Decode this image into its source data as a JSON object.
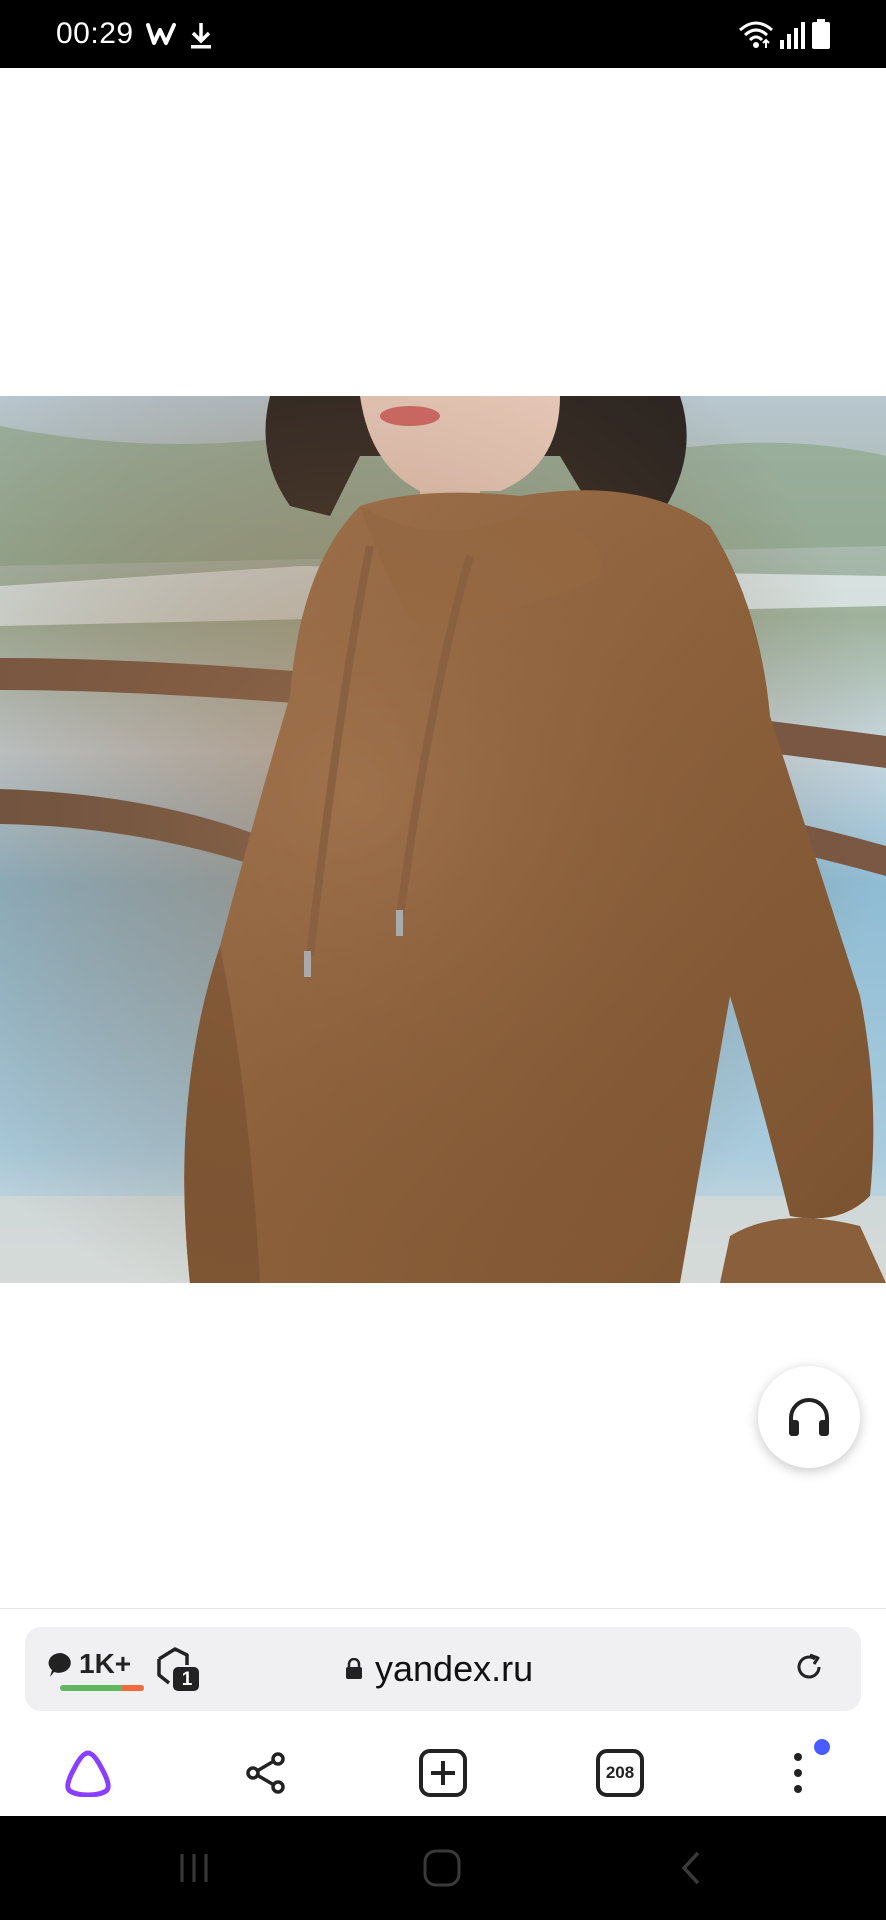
{
  "status_bar": {
    "time": "00:29",
    "icons": [
      "w-app-icon",
      "download-icon",
      "wifi-icon",
      "signal-icon",
      "battery-icon"
    ]
  },
  "page": {
    "image": "product-photo-brown-hoodie"
  },
  "audio_button": {
    "icon": "headphones-icon"
  },
  "browser": {
    "comments_count": "1K+",
    "protect_badge": "1",
    "url": "yandex.ru",
    "tabs_count": "208",
    "accent": "#8a3ffc",
    "notification_dot_color": "#4a5cff",
    "rating_bar_colors": [
      "#5cb85c",
      "#f06a3c"
    ],
    "nav_icons": [
      "alice-icon",
      "share-icon",
      "new-tab-icon",
      "tabs-icon",
      "menu-icon"
    ]
  },
  "system_nav": {
    "icons": [
      "recents-icon",
      "home-icon",
      "back-icon"
    ]
  }
}
